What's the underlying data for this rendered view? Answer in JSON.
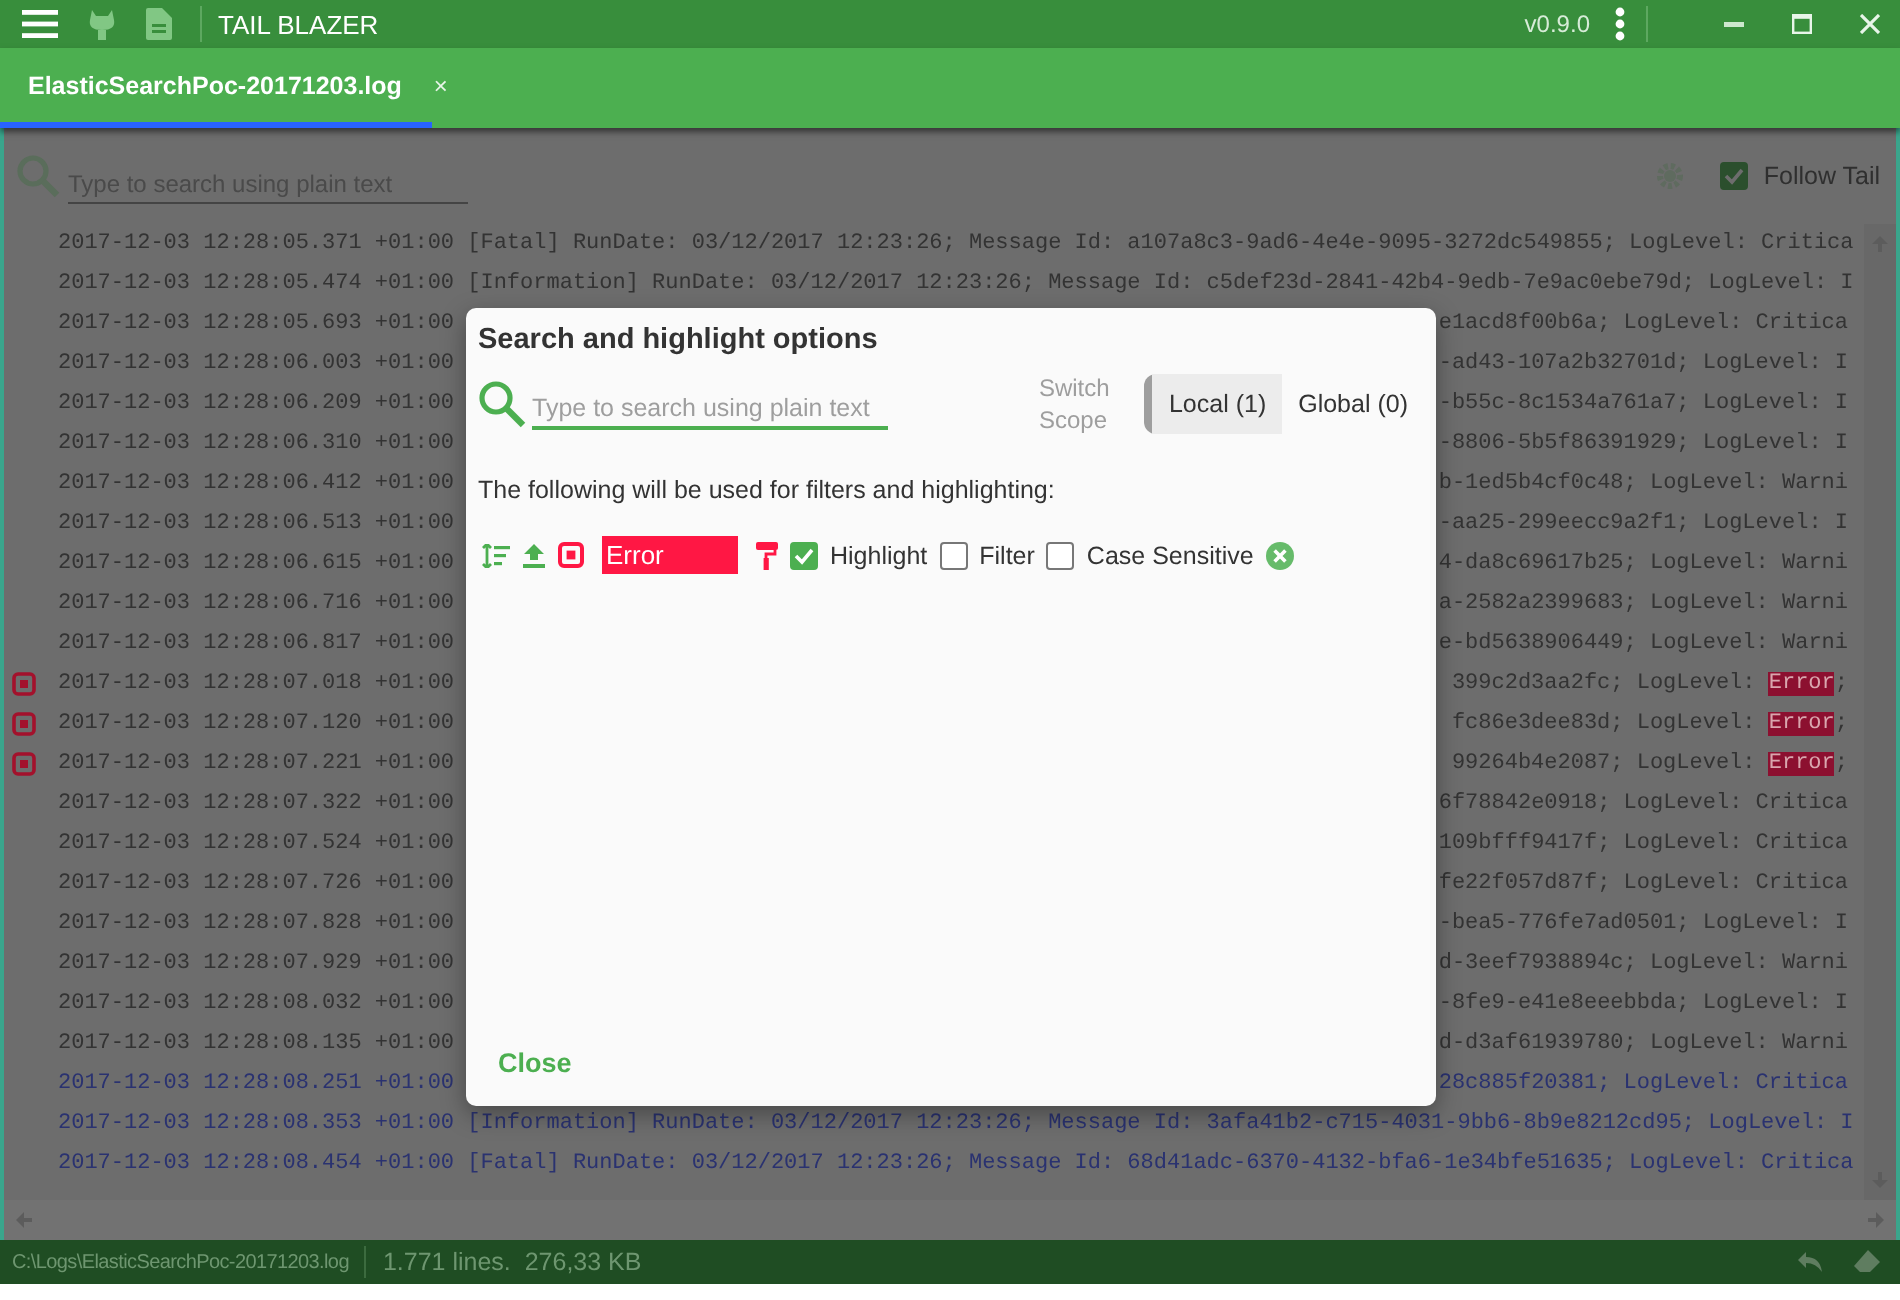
{
  "title_bar": {
    "title": "TAIL BLAZER",
    "version": "v0.9.0"
  },
  "tabs": [
    {
      "label": "ElasticSearchPoc-20171203.log",
      "close": "×",
      "selected": true
    }
  ],
  "toolbar": {
    "search_placeholder": "Type to search using plain text",
    "follow_tail": {
      "label": "Follow Tail",
      "checked": true
    }
  },
  "log_lines": [
    {
      "left": "2017-12-03 12:28:05.371 +01:00 [Fatal] RunDate: 03/12/2017 12:23:26; Message Id: a107a8c3-9ad6-4e4e-9095-3272dc549855; LogLevel: Critica",
      "flagged": false,
      "recent": false
    },
    {
      "left": "2017-12-03 12:28:05.474 +01:00 [Information] RunDate: 03/12/2017 12:23:26; Message Id: c5def23d-2841-42b4-9edb-7e9ac0ebe79d; LogLevel: I",
      "flagged": false,
      "recent": false
    },
    {
      "left": "2017-12-03 12:28:05.693 +01:00",
      "right": "e1acd8f00b6a; LogLevel: Critica",
      "flagged": false,
      "recent": false
    },
    {
      "left": "2017-12-03 12:28:06.003 +01:00",
      "right": "-ad43-107a2b32701d; LogLevel: I",
      "flagged": false,
      "recent": false
    },
    {
      "left": "2017-12-03 12:28:06.209 +01:00",
      "right": "-b55c-8c1534a761a7; LogLevel: I",
      "flagged": false,
      "recent": false
    },
    {
      "left": "2017-12-03 12:28:06.310 +01:00",
      "right": "-8806-5b5f86391929; LogLevel: I",
      "flagged": false,
      "recent": false
    },
    {
      "left": "2017-12-03 12:28:06.412 +01:00",
      "right": "b-1ed5b4cf0c48; LogLevel: Warni",
      "flagged": false,
      "recent": false
    },
    {
      "left": "2017-12-03 12:28:06.513 +01:00",
      "right": "-aa25-299eecc9a2f1; LogLevel: I",
      "flagged": false,
      "recent": false
    },
    {
      "left": "2017-12-03 12:28:06.615 +01:00",
      "right": "4-da8c69617b25; LogLevel: Warni",
      "flagged": false,
      "recent": false
    },
    {
      "left": "2017-12-03 12:28:06.716 +01:00",
      "right": "a-2582a2399683; LogLevel: Warni",
      "flagged": false,
      "recent": false
    },
    {
      "left": "2017-12-03 12:28:06.817 +01:00",
      "right": "e-bd5638906449; LogLevel: Warni",
      "flagged": false,
      "recent": false
    },
    {
      "left": "2017-12-03 12:28:07.018 +01:00",
      "right": "399c2d3aa2fc; LogLevel: ",
      "match": "Error",
      "tail": ";",
      "flagged": true,
      "recent": false
    },
    {
      "left": "2017-12-03 12:28:07.120 +01:00",
      "right": "fc86e3dee83d; LogLevel: ",
      "match": "Error",
      "tail": ";",
      "flagged": true,
      "recent": false
    },
    {
      "left": "2017-12-03 12:28:07.221 +01:00",
      "right": "99264b4e2087; LogLevel: ",
      "match": "Error",
      "tail": ";",
      "flagged": true,
      "recent": false
    },
    {
      "left": "2017-12-03 12:28:07.322 +01:00",
      "right": "6f78842e0918; LogLevel: Critica",
      "flagged": false,
      "recent": false
    },
    {
      "left": "2017-12-03 12:28:07.524 +01:00",
      "right": "109bfff9417f; LogLevel: Critica",
      "flagged": false,
      "recent": false
    },
    {
      "left": "2017-12-03 12:28:07.726 +01:00",
      "right": "fe22f057d87f; LogLevel: Critica",
      "flagged": false,
      "recent": false
    },
    {
      "left": "2017-12-03 12:28:07.828 +01:00",
      "right": "-bea5-776fe7ad0501; LogLevel: I",
      "flagged": false,
      "recent": false
    },
    {
      "left": "2017-12-03 12:28:07.929 +01:00",
      "right": "d-3eef7938894c; LogLevel: Warni",
      "flagged": false,
      "recent": false
    },
    {
      "left": "2017-12-03 12:28:08.032 +01:00",
      "right": "-8fe9-e41e8eeebbda; LogLevel: I",
      "flagged": false,
      "recent": false
    },
    {
      "left": "2017-12-03 12:28:08.135 +01:00",
      "right": "d-d3af61939780; LogLevel: Warni",
      "flagged": false,
      "recent": false
    },
    {
      "left": "2017-12-03 12:28:08.251 +01:00",
      "right": "28c885f20381; LogLevel: Critica",
      "flagged": false,
      "recent": true
    },
    {
      "left": "2017-12-03 12:28:08.353 +01:00 [Information] RunDate: 03/12/2017 12:23:26; Message Id: 3afa41b2-c715-4031-9bb6-8b9e8212cd95; LogLevel: I",
      "flagged": false,
      "recent": true
    },
    {
      "left": "2017-12-03 12:28:08.454 +01:00 [Fatal] RunDate: 03/12/2017 12:23:26; Message Id: 68d41adc-6370-4132-bfa6-1e34bfe51635; LogLevel: Critica",
      "flagged": false,
      "recent": true
    }
  ],
  "status_bar": {
    "path": "C:\\Logs\\ElasticSearchPoc-20171203.log",
    "summary": "1.771 lines.  276,33 KB"
  },
  "dialog": {
    "title": "Search and highlight options",
    "search_placeholder": "Type to search using plain text",
    "scope_label": "Switch Scope",
    "scopes": [
      {
        "label": "Local (1)",
        "selected": true
      },
      {
        "label": "Global (0)",
        "selected": false
      }
    ],
    "description": "The following will be used for filters and highlighting:",
    "terms": [
      {
        "text": "Error",
        "color": "#ff1744",
        "options": [
          {
            "label": "Highlight",
            "checked": true
          },
          {
            "label": "Filter",
            "checked": false
          },
          {
            "label": "Case Sensitive",
            "checked": false
          }
        ]
      }
    ],
    "close": "Close"
  }
}
